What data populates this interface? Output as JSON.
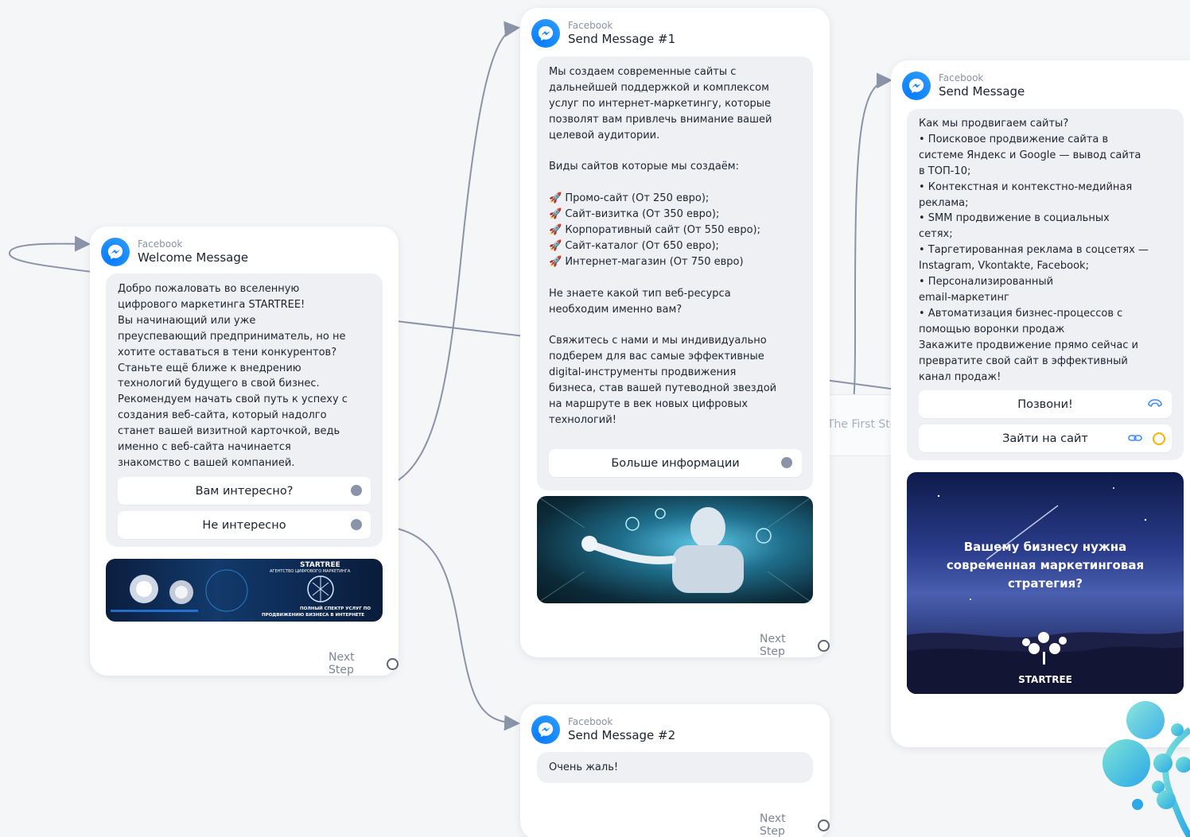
{
  "nodes": {
    "welcome": {
      "source": "Facebook",
      "title": "Welcome Message",
      "text": "Добро пожаловать во вселенную\nцифрового маркетинга STARTREE!\nВы начинающий или уже\nпреуспевающий предприниматель, но не\nхотите оставаться в тени конкурентов?\nСтаньте ещё ближе к внедрению\nтехнологий будущего в свой бизнес.\nРекомендуем начать свой путь к успеху с\nсоздания веб-сайта, который надолго\nстанет вашей визитной карточкой, ведь\nименно с веб-сайта начинается\nзнакомство с вашей компанией.",
      "buttons": [
        "Вам интересно?",
        "Не интересно"
      ],
      "banner": {
        "brand": "STARTREE",
        "tagline": "АГЕНТСТВО ЦИФРОВОГО МАРКЕТИНГА",
        "subtitle_line1": "ПОЛНЫЙ СПЕКТР УСЛУГ ПО",
        "subtitle_line2": "ПРОДВИЖЕНИЮ БИЗНЕСА В ИНТЕРНЕТЕ"
      },
      "next_step": "Next Step"
    },
    "msg1": {
      "source": "Facebook",
      "title": "Send Message #1",
      "text": "Мы создаем современные сайты с\nдальнейшей поддержкой и комплексом\nуслуг по интернет-маркетингу, которые\nпозволят вам привлечь внимание вашей\nцелевой аудитории.\n\nВиды сайтов которые мы создаём:\n\n🚀 Промо-сайт (От 250 евро);\n🚀 Сайт-визитка (От 350 евро);\n🚀 Корпоративный сайт (От 550 евро);\n🚀 Сайт-каталог (От 650 евро);\n🚀 Интернет-магазин (От 750 евро)\n\nНе знаете какой тип веб-ресурса\nнеобходим именно вам?\n\nСвяжитесь с нами и мы индивидуально\nподберем для вас самые эффективные\ndigital-инструменты продвижения\nбизнеса, став вашей путеводной звездой\nна маршруте в век новых цифровых\nтехнологий!",
      "buttons": [
        "Больше информации"
      ],
      "next_step": "Next Step"
    },
    "msg2": {
      "source": "Facebook",
      "title": "Send Message #2",
      "text": "Очень жаль!",
      "next_step": "Next Step"
    },
    "msg3": {
      "source": "Facebook",
      "title": "Send Message",
      "text": "Как мы продвигаем сайты?\n• Поисковое продвижение сайта в\nсистеме Яндекс и Google — вывод сайта\nв ТОП-10;\n• Контекстная и контекстно-медийная\nреклама;\n• SMM продвижение в социальных\nсетях;\n• Таргетированная реклама в соцсетях —\nInstagram, Vkontakte, Facebook;\n• Персонализированный\nemail-маркетинг\n• Автоматизация бизнес-процессов с\nпомощью воронки продаж\nЗакажите продвижение прямо сейчас и\nпревратите свой сайт в эффективный\nканал продаж!",
      "buttons": [
        "Позвони!",
        "Зайти на сайт"
      ],
      "poster": {
        "headline_line1": "Вашему бизнесу нужна",
        "headline_line2": "современная маркетинговая",
        "headline_line3": "стратегия?",
        "brand": "STARTREE"
      }
    },
    "first_step": {
      "label": "The First Step"
    }
  },
  "icons": {
    "node_icon": "messenger-icon",
    "phone": "phone-icon",
    "link": "link-icon"
  },
  "colors": {
    "connector": "#8a93a8",
    "port": "#8a93a8",
    "link_icon": "#3f8cff",
    "ring_orange": "#f5b400"
  }
}
